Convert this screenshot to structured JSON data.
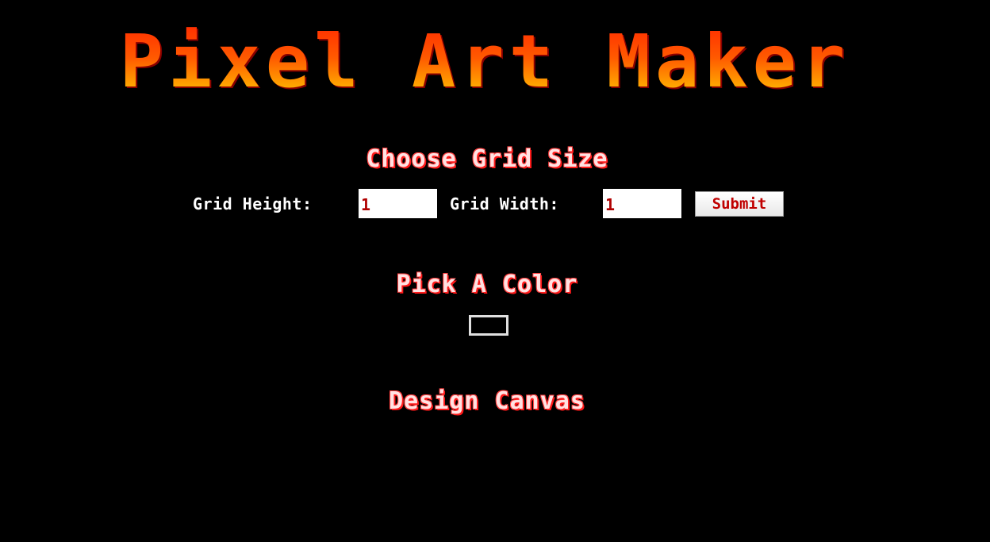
{
  "app": {
    "title": "Pixel Art Maker"
  },
  "grid_size": {
    "heading": "Choose Grid Size",
    "height_label": "Grid Height:",
    "height_value": "1",
    "width_label": "Grid Width:",
    "width_value": "1",
    "submit_label": "Submit"
  },
  "color": {
    "heading": "Pick A Color",
    "selected_value": "#000000"
  },
  "canvas": {
    "heading": "Design Canvas"
  },
  "colors": {
    "background": "#000000",
    "title_gradient_top": "#ff2a00",
    "title_gradient_bottom": "#ffd000",
    "heading_glow": "#ff1a1a",
    "input_text": "#b00000"
  }
}
